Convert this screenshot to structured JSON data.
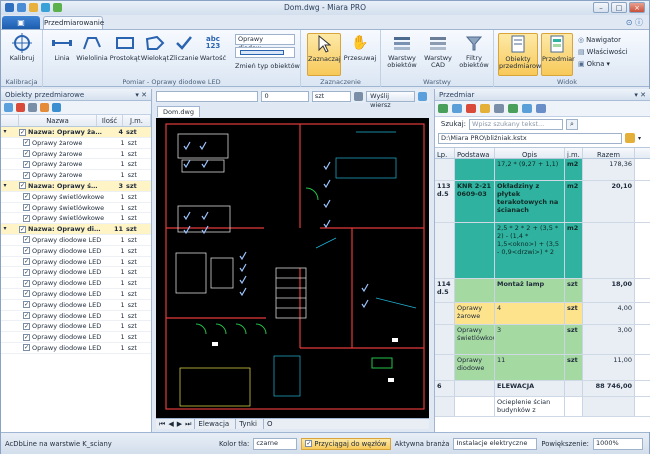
{
  "window": {
    "title": "Dom.dwg - Miara PRO"
  },
  "ribbon": {
    "tabs": [
      "Przedmiarowanie"
    ],
    "groups": {
      "kalibracja": {
        "label": "Kalibracja",
        "buttons": [
          "Kalibruj"
        ]
      },
      "pomiar": {
        "label": "Pomiar - Oprawy diodowe LED",
        "buttons": [
          "Linia",
          "Wielolinia",
          "Prostokąt",
          "Wielokąt",
          "Zliczanie",
          "Wartość"
        ],
        "dropdown": "Oprawy diodow...",
        "change_type": "Zmień typ obiektów"
      },
      "zaznaczenie": {
        "label": "Zaznaczenie",
        "buttons": [
          "Zaznaczaj",
          "Przesuwaj"
        ]
      },
      "warstwy": {
        "label": "Warstwy",
        "buttons": [
          "Warstwy obiektów",
          "Warstwy CAD",
          "Filtry obiektów"
        ]
      },
      "widok": {
        "label": "Widok",
        "buttons": [
          "Obiekty przedmiarowe",
          "Przedmiar"
        ],
        "small": [
          "Nawigator",
          "Właściwości",
          "Okna"
        ]
      }
    }
  },
  "left_panel": {
    "title": "Obiekty przedmiarowe",
    "columns": [
      "Nazwa",
      "Ilość",
      "J.m."
    ],
    "rows": [
      {
        "type": "group",
        "name": "Nazwa: Oprawy żaro...",
        "qty": "4",
        "unit": "szt"
      },
      {
        "type": "item",
        "name": "Oprawy żarowe",
        "qty": "1",
        "unit": "szt"
      },
      {
        "type": "item",
        "name": "Oprawy żarowe",
        "qty": "1",
        "unit": "szt"
      },
      {
        "type": "item",
        "name": "Oprawy żarowe",
        "qty": "1",
        "unit": "szt"
      },
      {
        "type": "item",
        "name": "Oprawy żarowe",
        "qty": "1",
        "unit": "szt"
      },
      {
        "type": "group",
        "name": "Nazwa: Oprawy świe...",
        "qty": "3",
        "unit": "szt"
      },
      {
        "type": "item",
        "name": "Oprawy świetlówkowe",
        "qty": "1",
        "unit": "szt"
      },
      {
        "type": "item",
        "name": "Oprawy świetlówkowe",
        "qty": "1",
        "unit": "szt"
      },
      {
        "type": "item",
        "name": "Oprawy świetlówkowe",
        "qty": "1",
        "unit": "szt"
      },
      {
        "type": "group",
        "name": "Nazwa: Oprawy diod...",
        "qty": "11",
        "unit": "szt"
      },
      {
        "type": "item",
        "name": "Oprawy diodowe LED",
        "qty": "1",
        "unit": "szt"
      },
      {
        "type": "item",
        "name": "Oprawy diodowe LED",
        "qty": "1",
        "unit": "szt"
      },
      {
        "type": "item",
        "name": "Oprawy diodowe LED",
        "qty": "1",
        "unit": "szt"
      },
      {
        "type": "item",
        "name": "Oprawy diodowe LED",
        "qty": "1",
        "unit": "szt"
      },
      {
        "type": "item",
        "name": "Oprawy diodowe LED",
        "qty": "1",
        "unit": "szt"
      },
      {
        "type": "item",
        "name": "Oprawy diodowe LED",
        "qty": "1",
        "unit": "szt"
      },
      {
        "type": "item",
        "name": "Oprawy diodowe LED",
        "qty": "1",
        "unit": "szt"
      },
      {
        "type": "item",
        "name": "Oprawy diodowe LED",
        "qty": "1",
        "unit": "szt"
      },
      {
        "type": "item",
        "name": "Oprawy diodowe LED",
        "qty": "1",
        "unit": "szt"
      },
      {
        "type": "item",
        "name": "Oprawy diodowe LED",
        "qty": "1",
        "unit": "szt"
      },
      {
        "type": "item",
        "name": "Oprawy diodowe LED",
        "qty": "1",
        "unit": "szt"
      }
    ]
  },
  "center": {
    "filter_value": "0",
    "filter_unit": "szt",
    "clear_label": "Wyślij wiersz",
    "doc_tab": "Dom.dwg",
    "layout_tabs": [
      "Elewacja",
      "Tynki",
      "O"
    ]
  },
  "right_panel": {
    "title": "Przedmiar",
    "search_label": "Szukaj:",
    "search_placeholder": "Wpisz szukany tekst...",
    "path": "D:\\Miara PRO\\bliźniak.kstx",
    "columns": [
      "Lp.",
      "Podstawa",
      "Opis",
      "j.m.",
      "Razem"
    ],
    "rows": [
      {
        "cls": "teal",
        "lp": "",
        "base": "",
        "desc": "17,2 * (9,27 + 1,1)",
        "unit": "m2",
        "total": "178,36",
        "tbold": false
      },
      {
        "cls": "teal",
        "lp": "113 d.5",
        "base": "KNR 2-21 0609-03",
        "desc": "Okładziny z płytek terakotowych na ścianach",
        "unit": "m2",
        "total": "20,10",
        "tbold": true
      },
      {
        "cls": "teal",
        "lp": "",
        "base": "",
        "desc": "2,5 * 2 * 2 + (3,5 * 2) - (1,4 * 1,5<okno>) + (3,5 - 0,9<drzwi>) * 2",
        "unit": "m2",
        "total": "",
        "tbold": false
      },
      {
        "cls": "green",
        "lp": "114 d.5",
        "base": "",
        "desc": "Montaż lamp",
        "unit": "szt",
        "total": "18,00",
        "tbold": true
      },
      {
        "cls": "yellow",
        "lp": "",
        "base": "Oprawy żarowe",
        "desc": "4",
        "unit": "szt",
        "total": "4,00",
        "tbold": false
      },
      {
        "cls": "green",
        "lp": "",
        "base": "Oprawy świetlówkowe",
        "desc": "3",
        "unit": "szt",
        "total": "3,00",
        "tbold": false
      },
      {
        "cls": "green",
        "lp": "",
        "base": "Oprawy diodowe",
        "desc": "11",
        "unit": "szt",
        "total": "11,00",
        "tbold": false
      },
      {
        "cls": "grey",
        "lp": "6",
        "base": "",
        "desc": "ELEWACJA",
        "unit": "",
        "total": "88 746,00",
        "tbold": true
      },
      {
        "cls": "white",
        "lp": "",
        "base": "",
        "desc": "Ocieplenie ścian budynków z",
        "unit": "",
        "total": "",
        "tbold": false
      }
    ]
  },
  "statusbar": {
    "text": "AcDbLine na warstwie K_sciany",
    "bg_label": "Kolor tła:",
    "bg_value": "czarne",
    "snap_label": "Przyciągaj do węzłów",
    "branch_label": "Aktywna branża",
    "branch_value": "Instalacje elektryczne",
    "zoom_label": "Powiększenie:",
    "zoom_value": "1000%"
  }
}
